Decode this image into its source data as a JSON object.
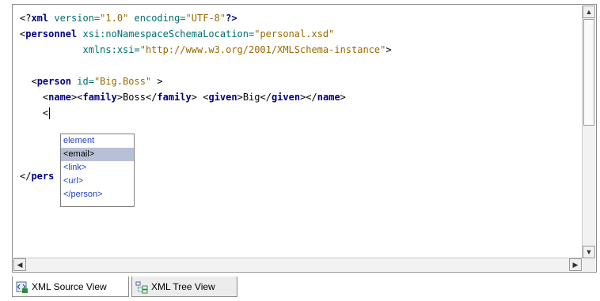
{
  "editor": {
    "lines": [
      {
        "parts": [
          {
            "t": "<?",
            "c": "punct"
          },
          {
            "t": "xml",
            "c": "pi"
          },
          {
            "t": " version=",
            "c": "attr"
          },
          {
            "t": "\"1.0\"",
            "c": "val"
          },
          {
            "t": " encoding=",
            "c": "attr"
          },
          {
            "t": "\"UTF-8\"",
            "c": "val"
          },
          {
            "t": "?>",
            "c": "pi"
          }
        ]
      },
      {
        "parts": [
          {
            "t": "<",
            "c": "punct"
          },
          {
            "t": "personnel",
            "c": "tag"
          },
          {
            "t": " xsi:noNamespaceSchemaLocation=",
            "c": "attr"
          },
          {
            "t": "\"personal.xsd\"",
            "c": "val"
          }
        ]
      },
      {
        "parts": [
          {
            "t": "           xmlns:xsi=",
            "c": "attr"
          },
          {
            "t": "\"http://www.w3.org/2001/XMLSchema-instance\"",
            "c": "val"
          },
          {
            "t": ">",
            "c": "punct"
          }
        ]
      },
      {
        "parts": []
      },
      {
        "parts": [
          {
            "t": "  <",
            "c": "punct"
          },
          {
            "t": "person",
            "c": "tag"
          },
          {
            "t": " id=",
            "c": "attr"
          },
          {
            "t": "\"Big.Boss\"",
            "c": "val"
          },
          {
            "t": " >",
            "c": "punct"
          }
        ]
      },
      {
        "parts": [
          {
            "t": "    <",
            "c": "punct"
          },
          {
            "t": "name",
            "c": "tag"
          },
          {
            "t": "><",
            "c": "punct"
          },
          {
            "t": "family",
            "c": "tag"
          },
          {
            "t": ">Boss</",
            "c": "punct"
          },
          {
            "t": "family",
            "c": "tag"
          },
          {
            "t": "> <",
            "c": "punct"
          },
          {
            "t": "given",
            "c": "tag"
          },
          {
            "t": ">Big</",
            "c": "punct"
          },
          {
            "t": "given",
            "c": "tag"
          },
          {
            "t": "></",
            "c": "punct"
          },
          {
            "t": "name",
            "c": "tag"
          },
          {
            "t": ">",
            "c": "punct"
          }
        ]
      },
      {
        "parts": [
          {
            "t": "    <",
            "c": "punct"
          }
        ],
        "caret": true
      },
      {
        "parts": []
      },
      {
        "parts": []
      },
      {
        "parts": []
      },
      {
        "parts": [
          {
            "t": "</",
            "c": "punct"
          },
          {
            "t": "pers",
            "c": "tag"
          }
        ]
      }
    ]
  },
  "autocomplete": {
    "items": [
      "element",
      "<email>",
      "<link>",
      "<url>",
      "</person>"
    ],
    "selected_index": 1
  },
  "tabs": {
    "source_label": "XML Source View",
    "tree_label": "XML Tree View"
  }
}
